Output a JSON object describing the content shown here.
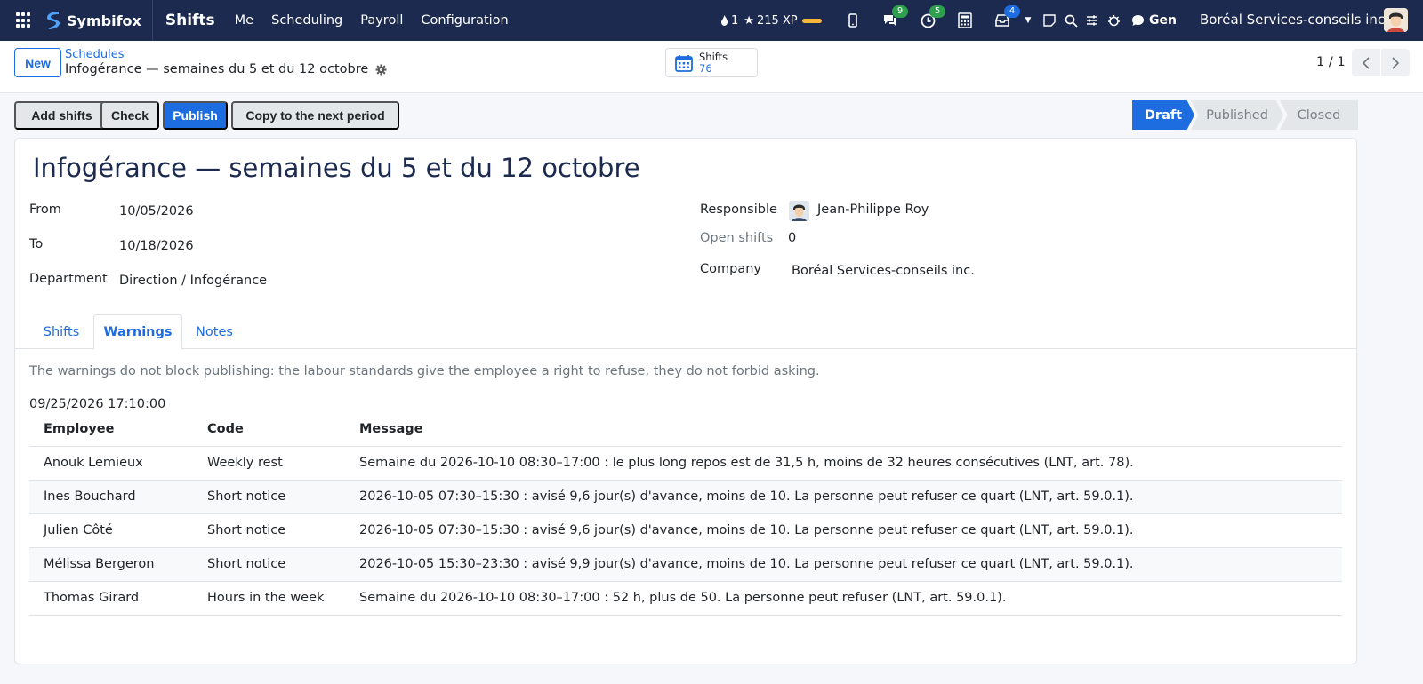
{
  "navbar": {
    "brand": "Symbifox",
    "app_name": "Shifts",
    "menu": [
      "Me",
      "Scheduling",
      "Payroll",
      "Configuration"
    ],
    "streak": "1",
    "xp": "215 XP",
    "messages_badge": "9",
    "activities_badge": "5",
    "notifications_badge": "4",
    "assistant_label": "Gen",
    "company": "Boréal Services-conseils inc."
  },
  "control_panel": {
    "new_label": "New",
    "breadcrumb_parent": "Schedules",
    "breadcrumb_current": "Infogérance — semaines du 5 et du 12 octobre",
    "smart_button_label": "Shifts",
    "smart_button_value": "76",
    "pager": "1 / 1"
  },
  "actions": {
    "add_shifts": "Add shifts",
    "check": "Check",
    "publish": "Publish",
    "copy_next": "Copy to the next period"
  },
  "stages": [
    "Draft",
    "Published",
    "Closed"
  ],
  "record": {
    "title": "Infogérance — semaines du 5 et du 12 octobre",
    "from_label": "From",
    "from_value": "10/05/2026",
    "to_label": "To",
    "to_value": "10/18/2026",
    "department_label": "Department",
    "department_value": "Direction / Infogérance",
    "responsible_label": "Responsible",
    "responsible_value": "Jean-Philippe Roy",
    "open_shifts_label": "Open shifts",
    "open_shifts_value": "0",
    "company_label": "Company",
    "company_value": "Boréal Services-conseils inc."
  },
  "tabs": [
    "Shifts",
    "Warnings",
    "Notes"
  ],
  "warnings": {
    "note": "The warnings do not block publishing: the labour standards give the employee a right to refuse, they do not forbid asking.",
    "date": "09/25/2026 17:10:00",
    "columns": [
      "Employee",
      "Code",
      "Message"
    ],
    "rows": [
      {
        "employee": "Anouk Lemieux",
        "code": "Weekly rest",
        "message": "Semaine du 2026-10-10 08:30–17:00 : le plus long repos est de 31,5 h, moins de 32 heures consécutives (LNT, art. 78)."
      },
      {
        "employee": "Ines Bouchard",
        "code": "Short notice",
        "message": "2026-10-05 07:30–15:30 : avisé 9,6 jour(s) d'avance, moins de 10. La personne peut refuser ce quart (LNT, art. 59.0.1)."
      },
      {
        "employee": "Julien Côté",
        "code": "Short notice",
        "message": "2026-10-05 07:30–15:30 : avisé 9,6 jour(s) d'avance, moins de 10. La personne peut refuser ce quart (LNT, art. 59.0.1)."
      },
      {
        "employee": "Mélissa Bergeron",
        "code": "Short notice",
        "message": "2026-10-05 15:30–23:30 : avisé 9,9 jour(s) d'avance, moins de 10. La personne peut refuser ce quart (LNT, art. 59.0.1)."
      },
      {
        "employee": "Thomas Girard",
        "code": "Hours in the week",
        "message": "Semaine du 2026-10-10 08:30–17:00 : 52 h, plus de 50. La personne peut refuser (LNT, art. 59.0.1)."
      }
    ]
  },
  "colors": {
    "navbar": "#1b2a4e",
    "primary": "#1d6ce0",
    "badge_green": "#2d9f4d"
  },
  "icons": [
    "apps-grid-icon",
    "brand-logo-icon",
    "fire-icon",
    "star-icon",
    "phone-icon",
    "chat-icon",
    "clock-icon",
    "calculator-icon",
    "inbox-icon",
    "caret-down-icon",
    "note-icon",
    "search-icon",
    "settings-sliders-icon",
    "bug-icon",
    "assistant-chat-icon",
    "gear-icon",
    "calendar-icon",
    "chevron-left-icon",
    "chevron-right-icon"
  ]
}
